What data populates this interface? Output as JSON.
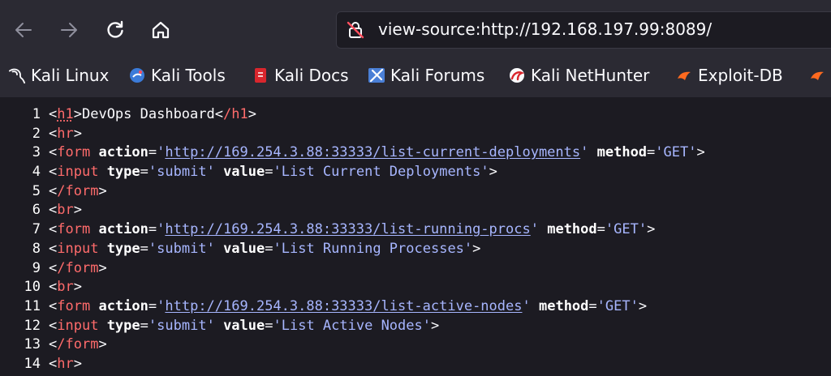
{
  "browser": {
    "url": "view-source:http://192.168.197.99:8089/",
    "icons": {
      "back": "arrow-left-icon",
      "forward": "arrow-right-icon",
      "reload": "reload-icon",
      "home": "home-icon",
      "insecure": "insecure-lock-icon"
    },
    "bookmarks": [
      {
        "label": "Kali Linux",
        "icon": "kali-dragon-icon"
      },
      {
        "label": "Kali Tools",
        "icon": "kali-tools-icon"
      },
      {
        "label": "Kali Docs",
        "icon": "kali-docs-icon"
      },
      {
        "label": "Kali Forums",
        "icon": "kali-forums-icon"
      },
      {
        "label": "Kali NetHunter",
        "icon": "kali-nethunter-icon"
      },
      {
        "label": "Exploit-DB",
        "icon": "exploit-db-icon"
      }
    ]
  },
  "source": {
    "lines": [
      {
        "n": "1"
      },
      {
        "n": "2"
      },
      {
        "n": "3"
      },
      {
        "n": "4"
      },
      {
        "n": "5"
      },
      {
        "n": "6"
      },
      {
        "n": "7"
      },
      {
        "n": "8"
      },
      {
        "n": "9"
      },
      {
        "n": "10"
      },
      {
        "n": "11"
      },
      {
        "n": "12"
      },
      {
        "n": "13"
      },
      {
        "n": "14"
      }
    ],
    "tokens": {
      "h1_open": "<",
      "h1": "h1",
      "gt": ">",
      "lt": "<",
      "title": "DevOps Dashboard",
      "h1_close_tag": "/h1",
      "hr": "hr",
      "br": "br",
      "form": "form",
      "form_close": "/form",
      "input": "input",
      "action_attr": "action",
      "method_attr": "method",
      "type_attr": "type",
      "value_attr": "value",
      "eq": "=",
      "quote": "'",
      "get": "GET",
      "submit": "submit",
      "url1": "http://169.254.3.88:33333/list-current-deployments",
      "url2": "http://169.254.3.88:33333/list-running-procs",
      "url3": "http://169.254.3.88:33333/list-active-nodes",
      "value1": "List Current Deployments",
      "value2": "List Running Processes",
      "value3": "List Active Nodes"
    }
  },
  "colors": {
    "background": "#1c1b22",
    "chrome": "#2b2a33",
    "tag": "#ff6b6b",
    "attr_value": "#a7b6ff"
  }
}
